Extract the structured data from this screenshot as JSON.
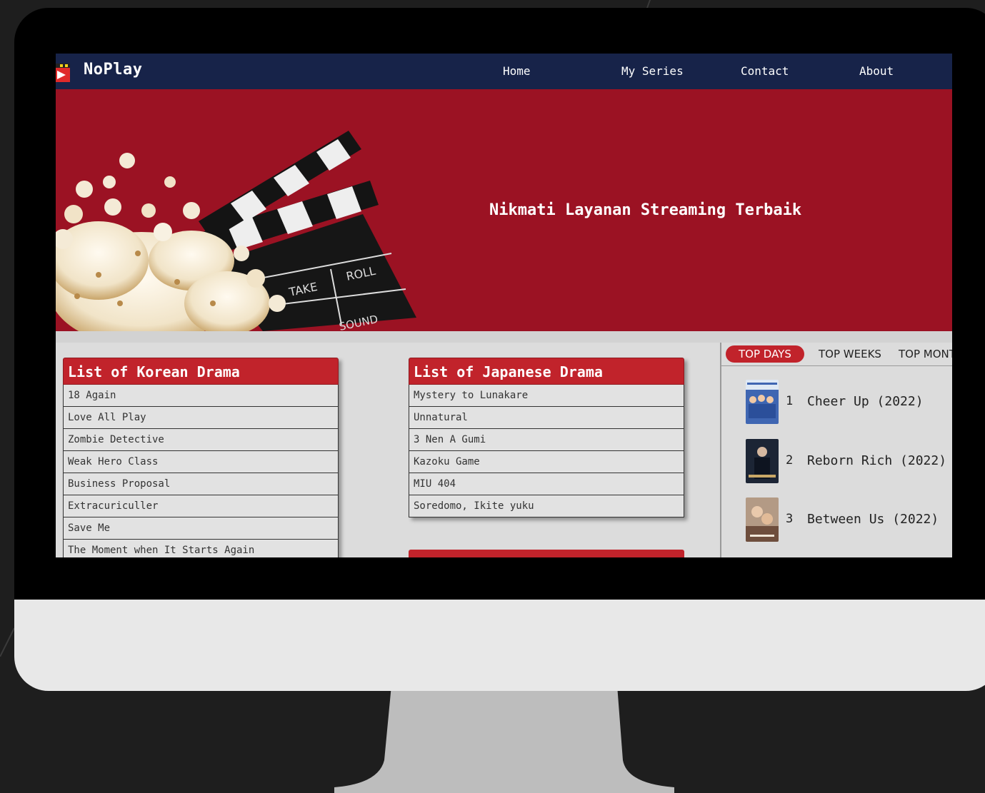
{
  "navbar": {
    "brand": "NoPlay",
    "links": [
      "Home",
      "My Series",
      "Contact",
      "About"
    ]
  },
  "hero": {
    "tagline": "Nikmati Layanan Streaming Terbaik",
    "clapper_words": [
      "TAKE",
      "ROLL",
      "SOUND"
    ]
  },
  "korean": {
    "title": "List of Korean Drama",
    "items": [
      "18 Again",
      "Love All Play",
      "Zombie Detective",
      "Weak Hero Class",
      "Business Proposal",
      "Extracuriculler",
      "Save Me",
      "The Moment when It Starts Again"
    ]
  },
  "japanese": {
    "title": "List of Japanese Drama",
    "items": [
      "Mystery to Lunakare",
      "Unnatural",
      "3 Nen A Gumi",
      "Kazoku Game",
      "MIU 404",
      "Soredomo, Ikite yuku"
    ]
  },
  "sidebar": {
    "tabs": [
      "TOP DAYS",
      "TOP WEEKS",
      "TOP MONT"
    ],
    "ranking": [
      {
        "num": "1",
        "title": "Cheer Up (2022)"
      },
      {
        "num": "2",
        "title": "Reborn Rich (2022)"
      },
      {
        "num": "3",
        "title": "Between Us (2022)"
      }
    ]
  },
  "colors": {
    "navbar": "#172349",
    "hero": "#9b1223",
    "accent": "#c1232b",
    "content_bg": "#dcdcdc"
  },
  "icons": [
    "noplay-logo-icon",
    "clapperboard-icon",
    "popcorn-image"
  ]
}
